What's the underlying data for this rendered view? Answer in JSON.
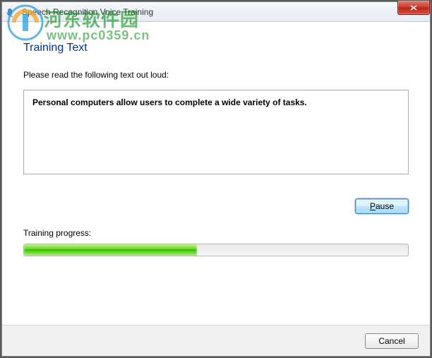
{
  "window": {
    "title": "Speech Recognition Voice Training"
  },
  "page": {
    "heading": "Training Text",
    "instruction": "Please read the following text out loud:",
    "training_text": "Personal computers allow users to complete a wide variety of tasks.",
    "pause_label": "Pause",
    "progress_label": "Training progress:",
    "progress_percent": 45
  },
  "footer": {
    "cancel_label": "Cancel"
  },
  "watermark": {
    "text": "河东软件园",
    "url": "www.pc0359.cn"
  }
}
